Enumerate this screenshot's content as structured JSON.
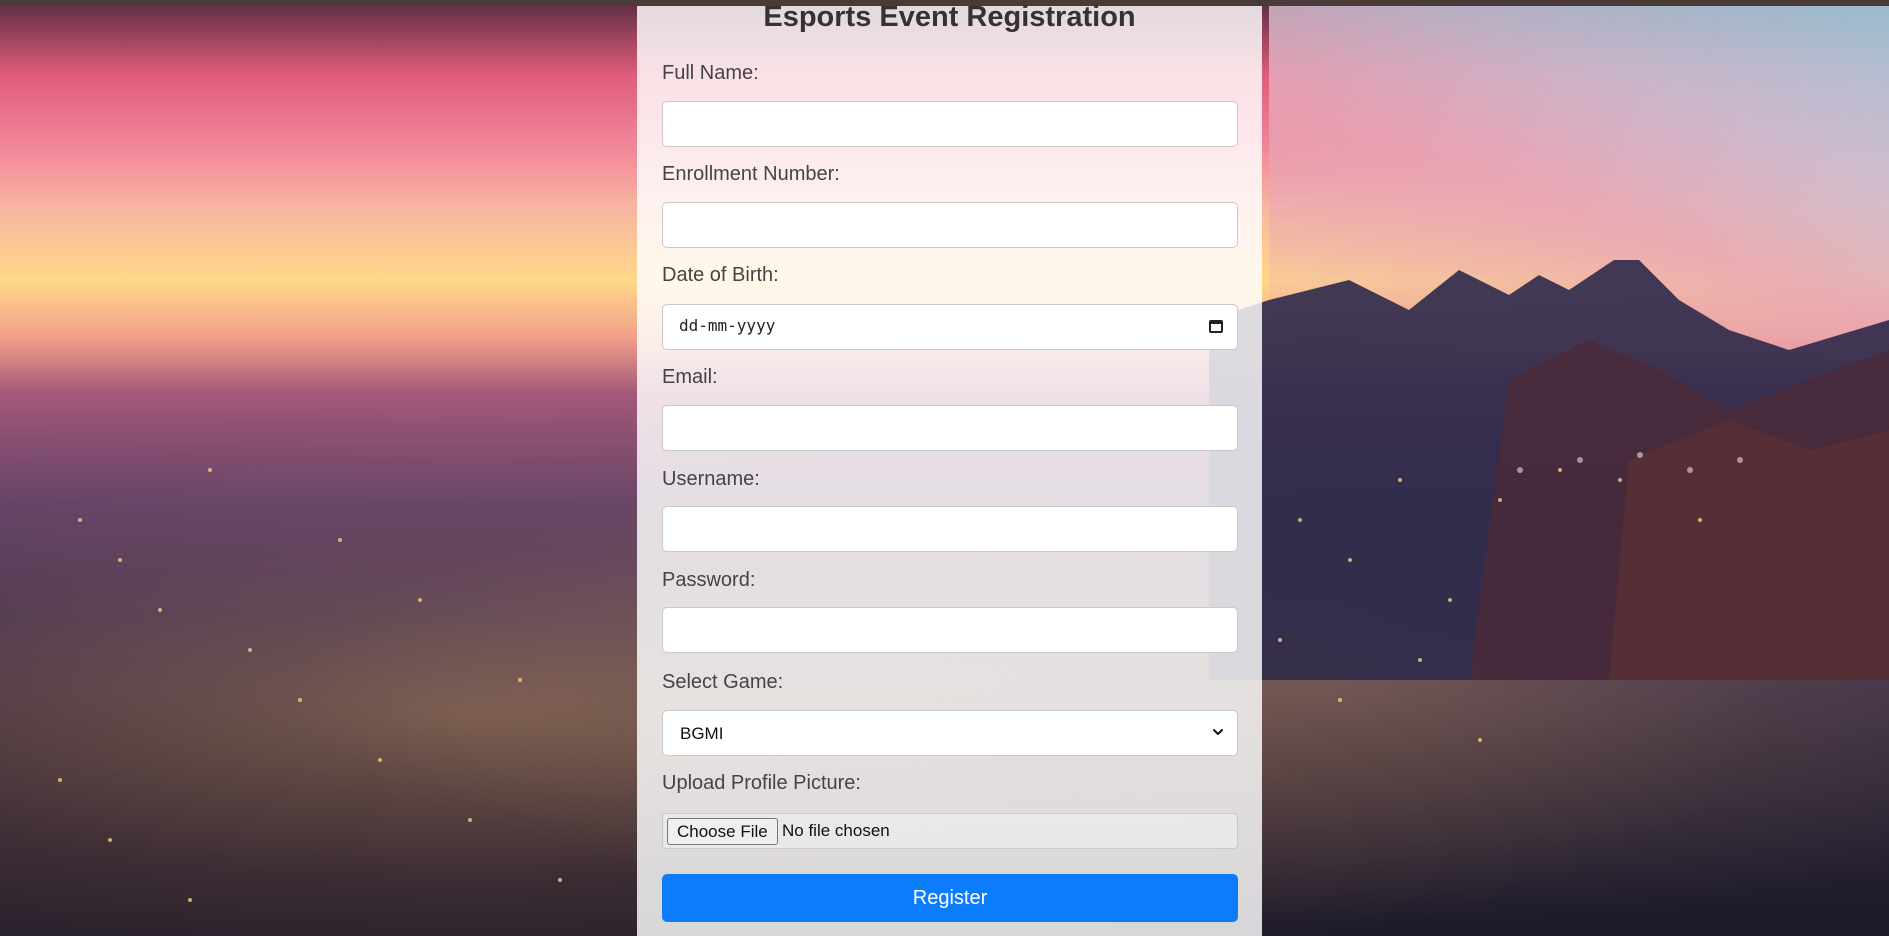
{
  "form": {
    "title": "Esports Event Registration",
    "fields": {
      "full_name": {
        "label": "Full Name:",
        "value": ""
      },
      "enrollment": {
        "label": "Enrollment Number:",
        "value": ""
      },
      "dob": {
        "label": "Date of Birth:",
        "value": "dd-mm-yyyy"
      },
      "email": {
        "label": "Email:",
        "value": ""
      },
      "username": {
        "label": "Username:",
        "value": ""
      },
      "password": {
        "label": "Password:",
        "value": ""
      },
      "game": {
        "label": "Select Game:",
        "selected": "BGMI"
      },
      "picture": {
        "label": "Upload Profile Picture:",
        "button": "Choose File",
        "status": "No file chosen"
      }
    },
    "submit_label": "Register"
  },
  "colors": {
    "accent": "#0b7dfc",
    "card_background": "rgba(255,255,255,0.82)"
  },
  "icons": {
    "date": "calendar-icon",
    "select": "chevron-down-icon"
  }
}
